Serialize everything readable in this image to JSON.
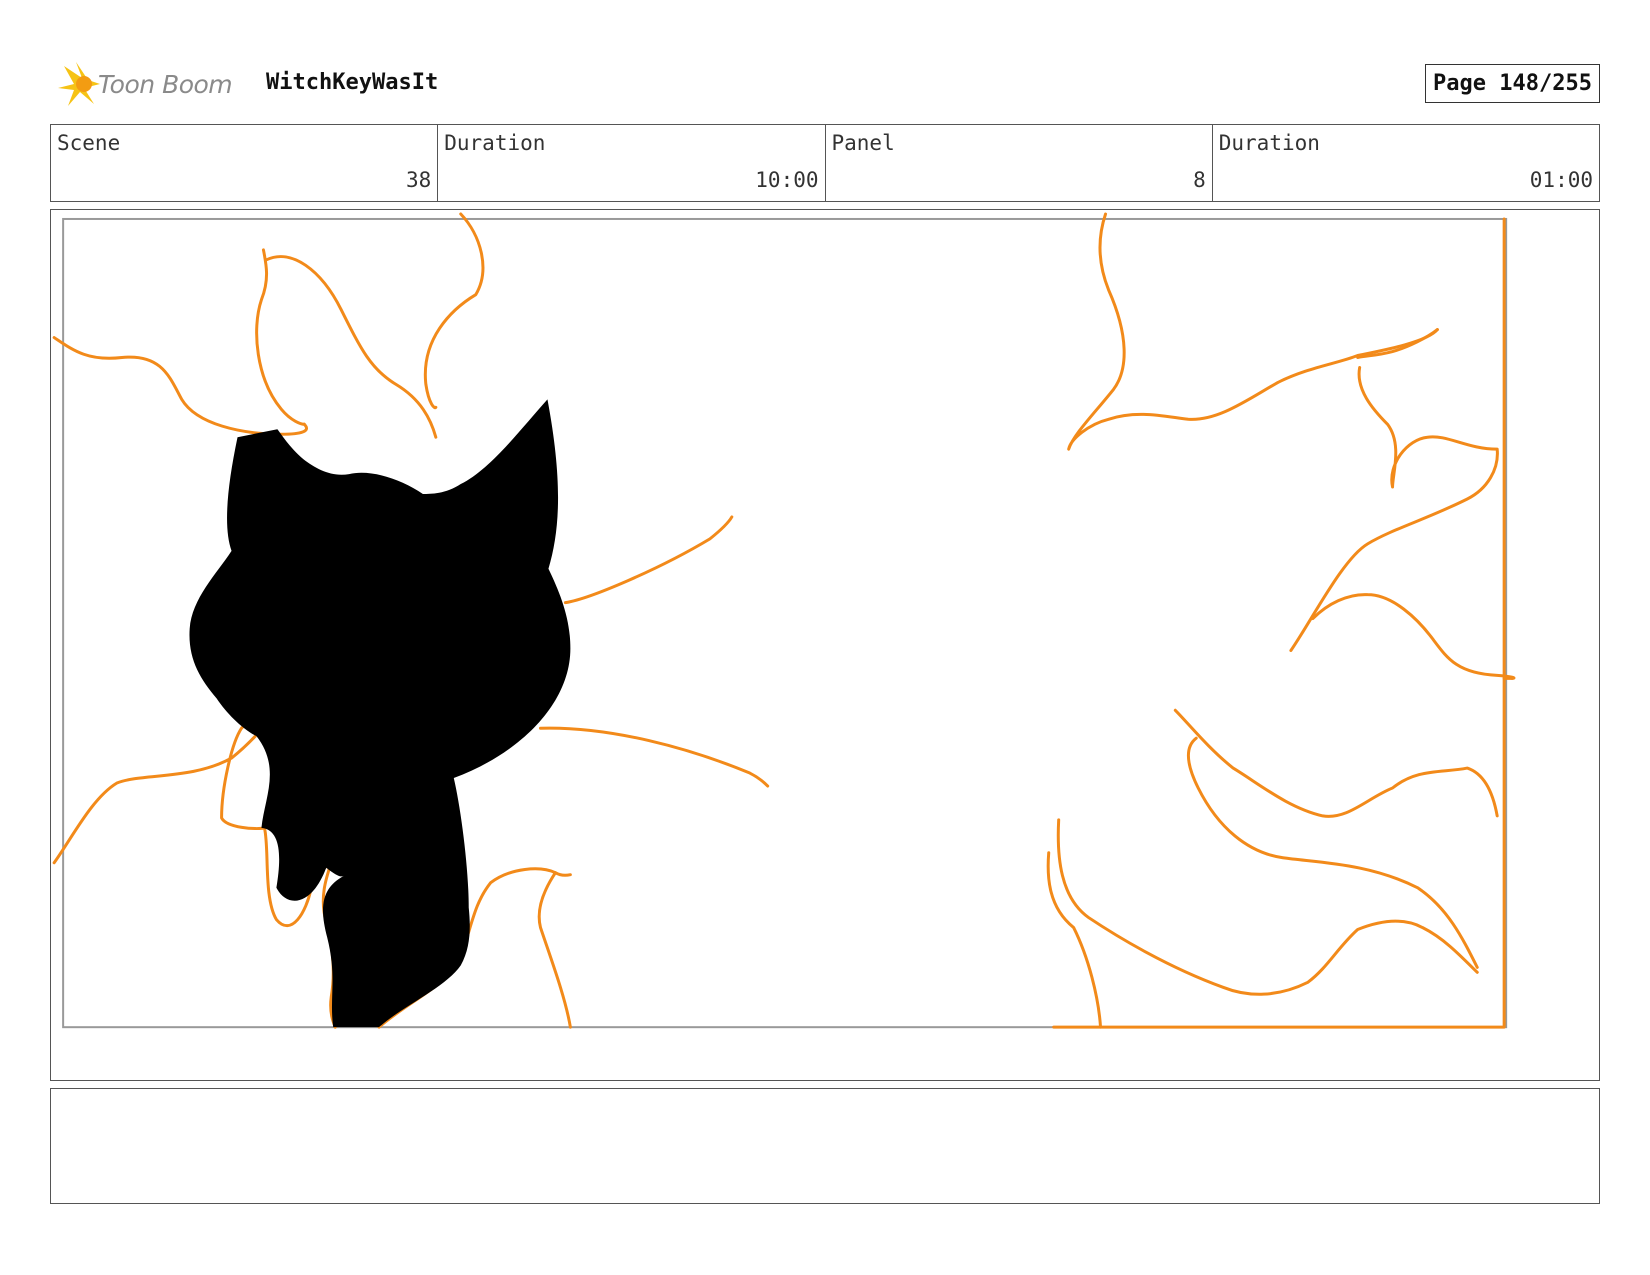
{
  "header": {
    "logo_text": "Toon Boom",
    "project_title": "WitchKeyWasIt",
    "page_label": "Page 148/255"
  },
  "info": [
    {
      "label": "Scene",
      "value": "38"
    },
    {
      "label": "Duration",
      "value": "10:00"
    },
    {
      "label": "Panel",
      "value": "8"
    },
    {
      "label": "Duration",
      "value": "01:00"
    }
  ],
  "colors": {
    "sketch_lines": "#f28a1a",
    "silhouette": "#000000",
    "logo_yellow": "#f6c315"
  },
  "notes": {
    "text": ""
  }
}
